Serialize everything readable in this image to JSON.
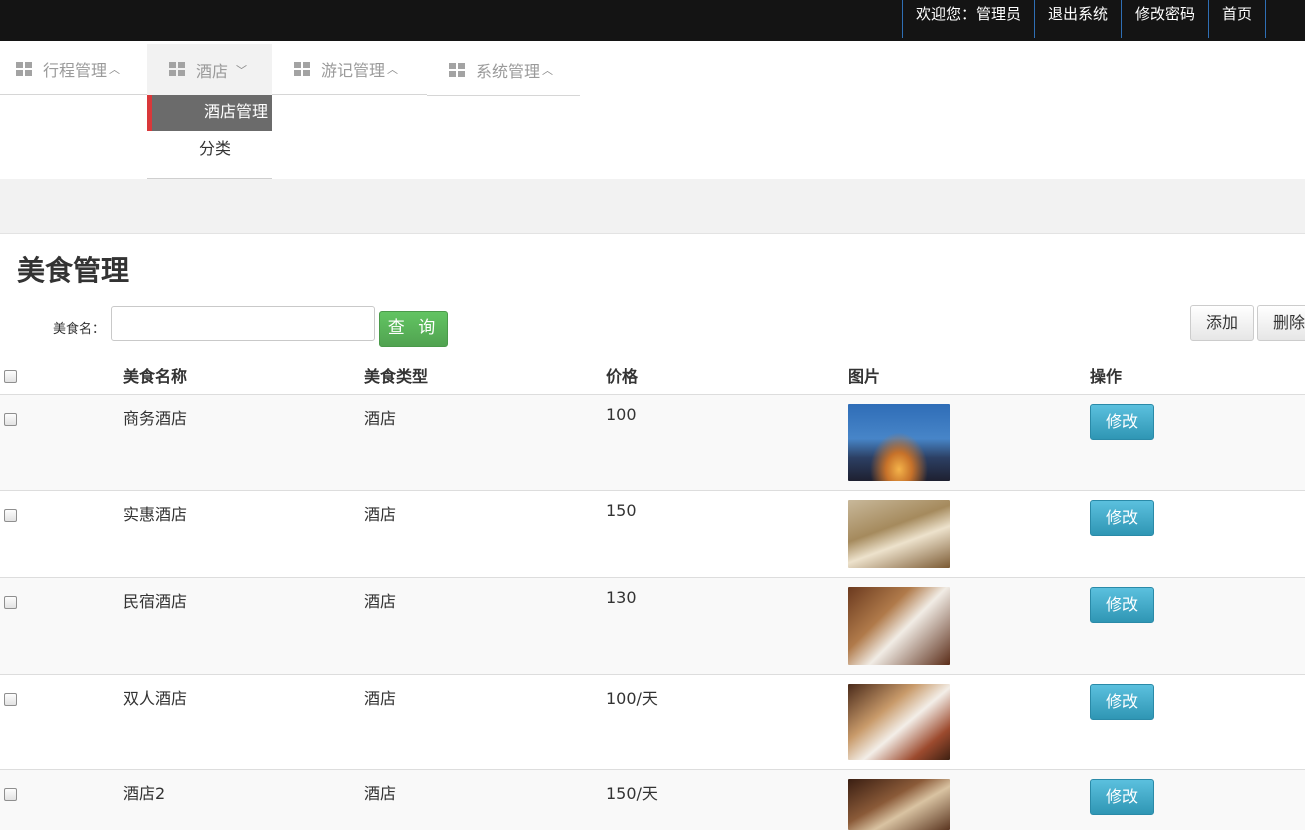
{
  "topbar": {
    "links": [
      "欢迎您：管理员",
      "退出系统",
      "修改密码",
      "首页"
    ]
  },
  "nav": {
    "items": [
      {
        "label": "行程管理",
        "caret": "^"
      },
      {
        "label": "酒店",
        "caret": "v"
      },
      {
        "label": "游记管理",
        "caret": "^"
      },
      {
        "label": "系统管理",
        "caret": "^"
      }
    ],
    "dropdown": [
      "酒店管理",
      "分类"
    ]
  },
  "page": {
    "title": "美食管理",
    "search_label": "美食名：",
    "search_value": "",
    "query_button": "查 询",
    "add_button": "添加",
    "delete_button": "删除"
  },
  "table": {
    "headers": [
      "美食名称",
      "美食类型",
      "价格",
      "图片",
      "操作"
    ],
    "rows": [
      {
        "name": "商务酒店",
        "type": "酒店",
        "price": "100",
        "image": "hotel-exterior-night",
        "action": "修改"
      },
      {
        "name": "实惠酒店",
        "type": "酒店",
        "price": "150",
        "image": "hotel-room-twin",
        "action": "修改"
      },
      {
        "name": "民宿酒店",
        "type": "酒店",
        "price": "130",
        "image": "hotel-room-warm",
        "action": "修改"
      },
      {
        "name": "双人酒店",
        "type": "酒店",
        "price": "100/天",
        "image": "hotel-room-double",
        "action": "修改"
      },
      {
        "name": "酒店2",
        "type": "酒店",
        "price": "150/天",
        "image": "hotel-room-suite",
        "action": "修改"
      }
    ]
  },
  "colors": {
    "topbar_bg": "#141414",
    "link_divider": "#2f6fb5",
    "query_green": "#51a351",
    "edit_blue": "#2f96b4",
    "menu_selected": "#6b6b6b",
    "menu_accent": "#d9383a"
  }
}
